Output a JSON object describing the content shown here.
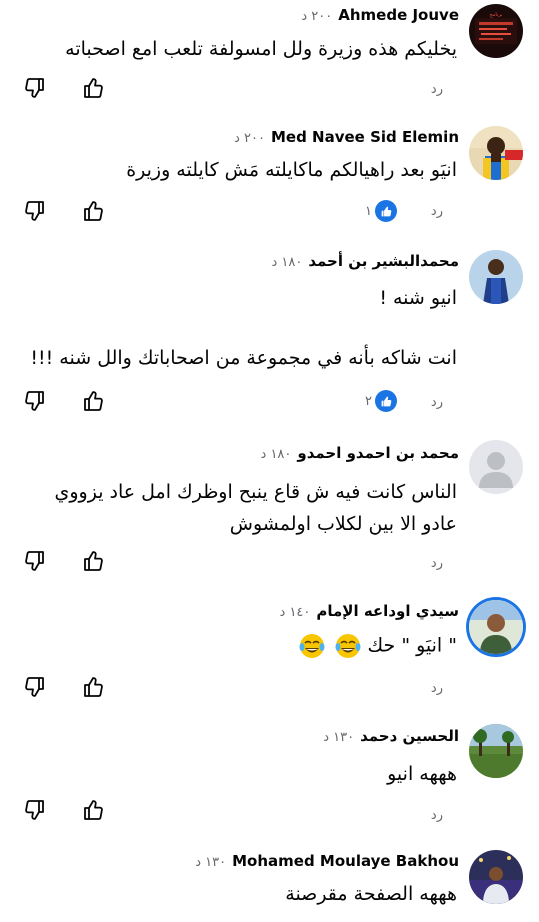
{
  "comments": [
    {
      "author": "Ahmede Jouve",
      "time": "٢٠٠ د",
      "lines": [
        "يخليكم هذه وزيرة ولل امسولفة تلعب امع اصحباته"
      ],
      "reply": "رد",
      "reactions": ""
    },
    {
      "author": "Med Navee Sid Elemin",
      "time": "٢٠٠ د",
      "lines": [
        "انيَو بعد راهيالكم ماكايلته مَش كايلته وزيرة"
      ],
      "reply": "رد",
      "reactions": "١"
    },
    {
      "author": "محمدالبشير بن أحمد",
      "time": "١٨٠ د",
      "lines": [
        "انيو شنه !",
        "",
        "انت شاكه بأنه في مجموعة من اصحاباتك والل شنه !!!"
      ],
      "reply": "رد",
      "reactions": "٢"
    },
    {
      "author": "محمد بن احمدو احمدو",
      "time": "١٨٠ د",
      "lines": [
        "الناس كانت فيه ش قاع ينبح  اوظرك امل عاد يزووي",
        "عادو الا بين لكلاب اولمشوش"
      ],
      "reply": "رد",
      "reactions": ""
    },
    {
      "author": "سيدي اوداعه الإمام",
      "time": "١٤٠ د",
      "lines": [
        "\" انيَو \" حك"
      ],
      "reply": "رد",
      "reactions": ""
    },
    {
      "author": "الحسين دحمد",
      "time": "١٣٠ د",
      "lines": [
        "هههه انيو"
      ],
      "reply": "رد",
      "reactions": ""
    },
    {
      "author": "Mohamed Moulaye Bakhou",
      "time": "١٣٠ د",
      "lines": [
        "هههه الصفحة مقرصنة"
      ],
      "reply": "",
      "reactions": ""
    }
  ],
  "avatar_banner_text": "برنامج",
  "emoji": [
    "face-with-tears-of-joy",
    "face-with-tears-of-joy"
  ],
  "colors": {
    "like_blue": "#1b74e4",
    "text": "#050505",
    "secondary": "#65676b"
  }
}
